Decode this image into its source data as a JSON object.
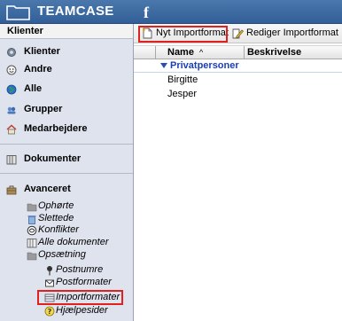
{
  "app": {
    "title": "TEAMCASE",
    "social_icon": "facebook-icon"
  },
  "sidebar": {
    "header": "Klienter",
    "items": [
      {
        "label": "Klienter",
        "icon": "gear-icon"
      },
      {
        "label": "Andre",
        "icon": "smiley-icon"
      },
      {
        "label": "Alle",
        "icon": "globe-icon"
      },
      {
        "label": "Grupper",
        "icon": "group-icon"
      },
      {
        "label": "Medarbejdere",
        "icon": "house-icon"
      }
    ],
    "documents": {
      "label": "Dokumenter",
      "icon": "binder-icon"
    },
    "advanced": {
      "label": "Avanceret",
      "icon": "toolbox-icon",
      "children": [
        {
          "label": "Ophørte",
          "icon": "folder-icon"
        },
        {
          "label": "Slettede",
          "icon": "trash-icon"
        },
        {
          "label": "Konflikter",
          "icon": "conflict-icon"
        },
        {
          "label": "Alle dokumenter",
          "icon": "documents-icon"
        },
        {
          "label": "Opsætning",
          "icon": "folder-icon"
        },
        {
          "label": "Postnumre",
          "icon": "pin-icon"
        },
        {
          "label": "Postformater",
          "icon": "envelope-icon"
        },
        {
          "label": "Importformater",
          "icon": "import-format-icon"
        },
        {
          "label": "Hjælpesider",
          "icon": "help-icon"
        }
      ]
    }
  },
  "toolbar": {
    "new_label": "Nyt Importformat",
    "edit_label": "Rediger Importformat"
  },
  "grid": {
    "columns": [
      "Name",
      "Beskrivelse"
    ],
    "sort_indicator": "^",
    "group_label": "Privatpersoner",
    "rows": [
      {
        "name": "Birgitte",
        "description": ""
      },
      {
        "name": "Jesper",
        "description": ""
      }
    ]
  },
  "colors": {
    "banner": "#3a68a2",
    "sidebar_bg": "#dfe3ee",
    "highlight": "#e0211d",
    "group_text": "#1a3fb8"
  }
}
